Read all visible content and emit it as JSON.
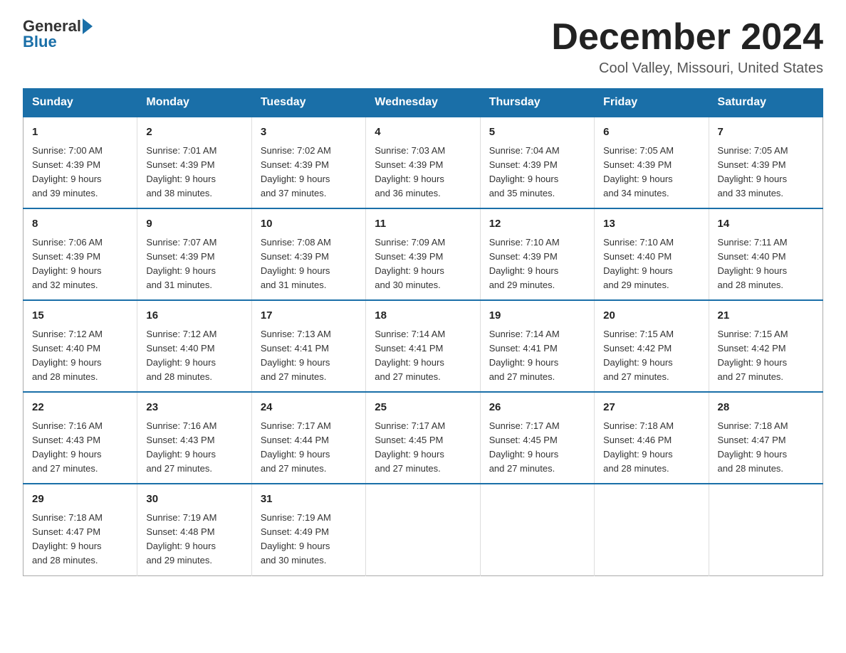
{
  "header": {
    "logo_general": "General",
    "logo_blue": "Blue",
    "month_title": "December 2024",
    "location": "Cool Valley, Missouri, United States"
  },
  "days_of_week": [
    "Sunday",
    "Monday",
    "Tuesday",
    "Wednesday",
    "Thursday",
    "Friday",
    "Saturday"
  ],
  "weeks": [
    [
      {
        "day": "1",
        "sunrise": "7:00 AM",
        "sunset": "4:39 PM",
        "daylight": "9 hours and 39 minutes."
      },
      {
        "day": "2",
        "sunrise": "7:01 AM",
        "sunset": "4:39 PM",
        "daylight": "9 hours and 38 minutes."
      },
      {
        "day": "3",
        "sunrise": "7:02 AM",
        "sunset": "4:39 PM",
        "daylight": "9 hours and 37 minutes."
      },
      {
        "day": "4",
        "sunrise": "7:03 AM",
        "sunset": "4:39 PM",
        "daylight": "9 hours and 36 minutes."
      },
      {
        "day": "5",
        "sunrise": "7:04 AM",
        "sunset": "4:39 PM",
        "daylight": "9 hours and 35 minutes."
      },
      {
        "day": "6",
        "sunrise": "7:05 AM",
        "sunset": "4:39 PM",
        "daylight": "9 hours and 34 minutes."
      },
      {
        "day": "7",
        "sunrise": "7:05 AM",
        "sunset": "4:39 PM",
        "daylight": "9 hours and 33 minutes."
      }
    ],
    [
      {
        "day": "8",
        "sunrise": "7:06 AM",
        "sunset": "4:39 PM",
        "daylight": "9 hours and 32 minutes."
      },
      {
        "day": "9",
        "sunrise": "7:07 AM",
        "sunset": "4:39 PM",
        "daylight": "9 hours and 31 minutes."
      },
      {
        "day": "10",
        "sunrise": "7:08 AM",
        "sunset": "4:39 PM",
        "daylight": "9 hours and 31 minutes."
      },
      {
        "day": "11",
        "sunrise": "7:09 AM",
        "sunset": "4:39 PM",
        "daylight": "9 hours and 30 minutes."
      },
      {
        "day": "12",
        "sunrise": "7:10 AM",
        "sunset": "4:39 PM",
        "daylight": "9 hours and 29 minutes."
      },
      {
        "day": "13",
        "sunrise": "7:10 AM",
        "sunset": "4:40 PM",
        "daylight": "9 hours and 29 minutes."
      },
      {
        "day": "14",
        "sunrise": "7:11 AM",
        "sunset": "4:40 PM",
        "daylight": "9 hours and 28 minutes."
      }
    ],
    [
      {
        "day": "15",
        "sunrise": "7:12 AM",
        "sunset": "4:40 PM",
        "daylight": "9 hours and 28 minutes."
      },
      {
        "day": "16",
        "sunrise": "7:12 AM",
        "sunset": "4:40 PM",
        "daylight": "9 hours and 28 minutes."
      },
      {
        "day": "17",
        "sunrise": "7:13 AM",
        "sunset": "4:41 PM",
        "daylight": "9 hours and 27 minutes."
      },
      {
        "day": "18",
        "sunrise": "7:14 AM",
        "sunset": "4:41 PM",
        "daylight": "9 hours and 27 minutes."
      },
      {
        "day": "19",
        "sunrise": "7:14 AM",
        "sunset": "4:41 PM",
        "daylight": "9 hours and 27 minutes."
      },
      {
        "day": "20",
        "sunrise": "7:15 AM",
        "sunset": "4:42 PM",
        "daylight": "9 hours and 27 minutes."
      },
      {
        "day": "21",
        "sunrise": "7:15 AM",
        "sunset": "4:42 PM",
        "daylight": "9 hours and 27 minutes."
      }
    ],
    [
      {
        "day": "22",
        "sunrise": "7:16 AM",
        "sunset": "4:43 PM",
        "daylight": "9 hours and 27 minutes."
      },
      {
        "day": "23",
        "sunrise": "7:16 AM",
        "sunset": "4:43 PM",
        "daylight": "9 hours and 27 minutes."
      },
      {
        "day": "24",
        "sunrise": "7:17 AM",
        "sunset": "4:44 PM",
        "daylight": "9 hours and 27 minutes."
      },
      {
        "day": "25",
        "sunrise": "7:17 AM",
        "sunset": "4:45 PM",
        "daylight": "9 hours and 27 minutes."
      },
      {
        "day": "26",
        "sunrise": "7:17 AM",
        "sunset": "4:45 PM",
        "daylight": "9 hours and 27 minutes."
      },
      {
        "day": "27",
        "sunrise": "7:18 AM",
        "sunset": "4:46 PM",
        "daylight": "9 hours and 28 minutes."
      },
      {
        "day": "28",
        "sunrise": "7:18 AM",
        "sunset": "4:47 PM",
        "daylight": "9 hours and 28 minutes."
      }
    ],
    [
      {
        "day": "29",
        "sunrise": "7:18 AM",
        "sunset": "4:47 PM",
        "daylight": "9 hours and 28 minutes."
      },
      {
        "day": "30",
        "sunrise": "7:19 AM",
        "sunset": "4:48 PM",
        "daylight": "9 hours and 29 minutes."
      },
      {
        "day": "31",
        "sunrise": "7:19 AM",
        "sunset": "4:49 PM",
        "daylight": "9 hours and 30 minutes."
      },
      null,
      null,
      null,
      null
    ]
  ],
  "labels": {
    "sunrise": "Sunrise: ",
    "sunset": "Sunset: ",
    "daylight": "Daylight: "
  }
}
